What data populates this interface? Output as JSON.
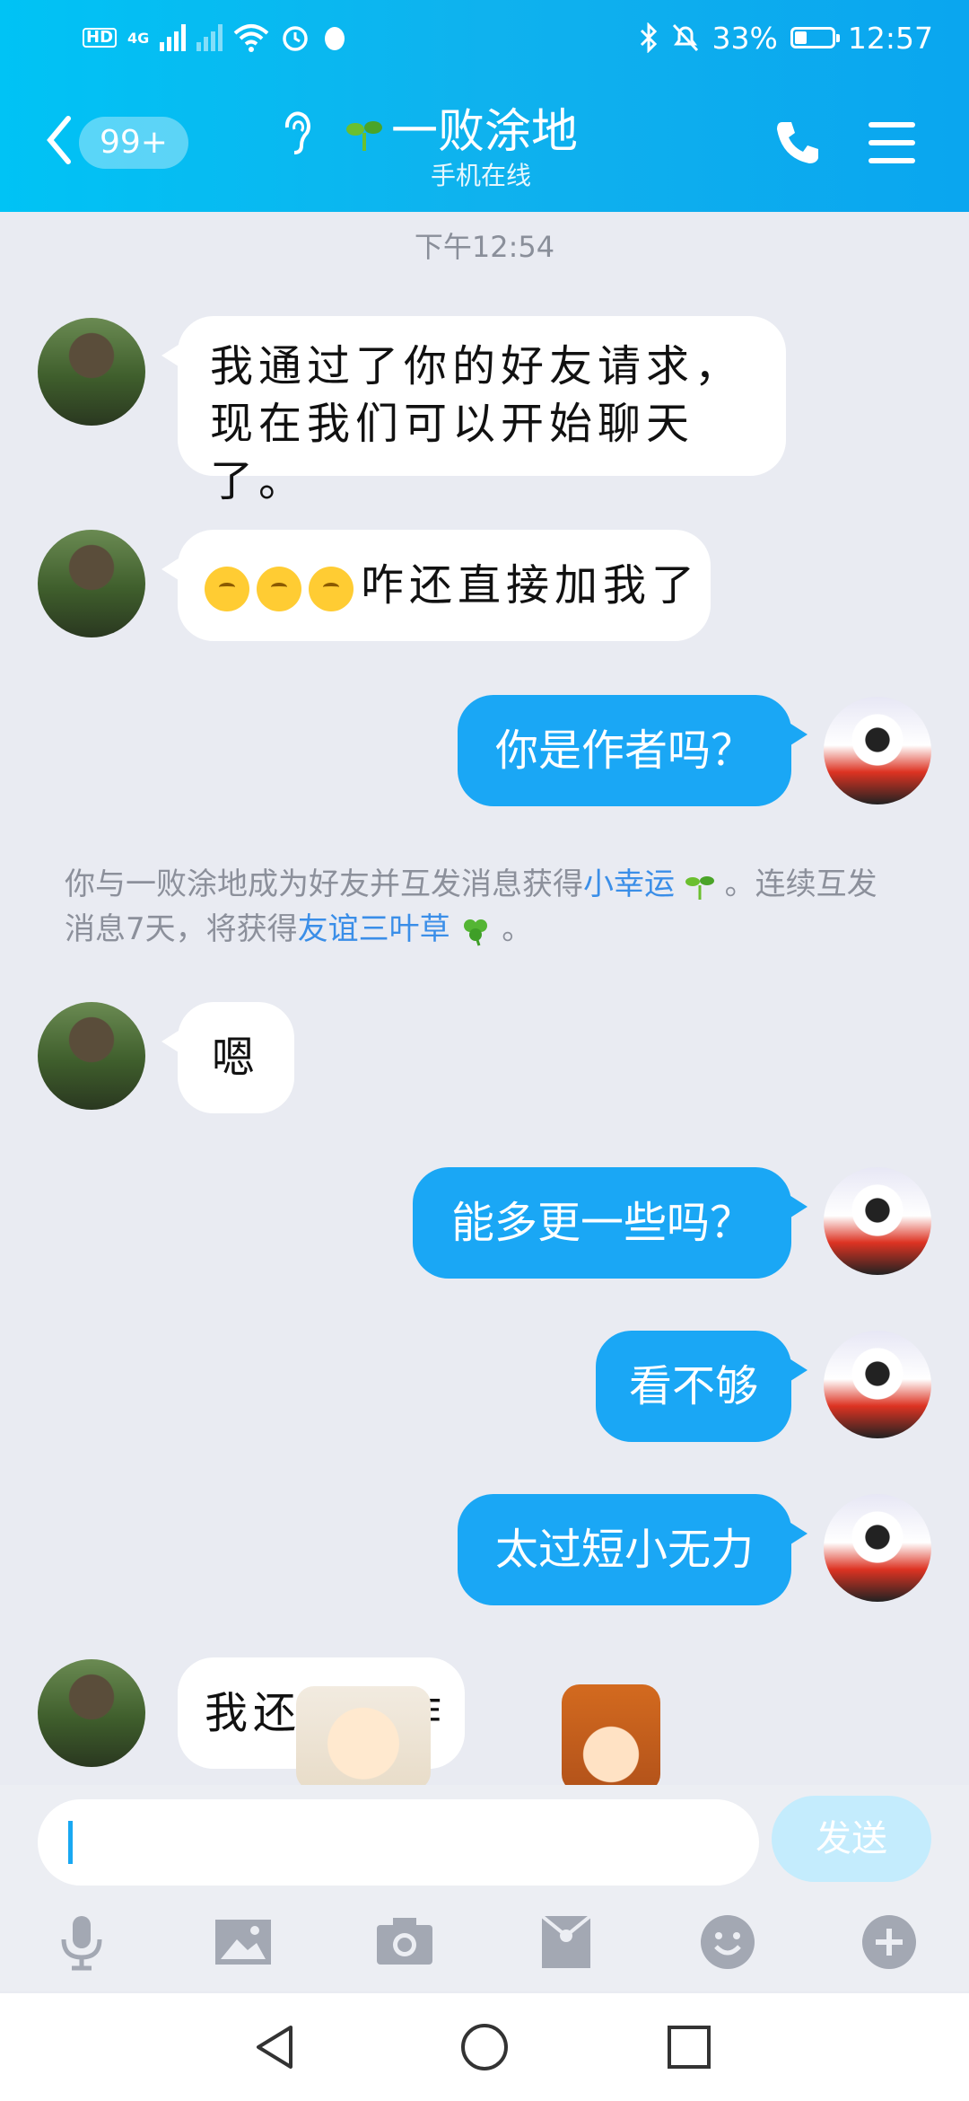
{
  "status_bar": {
    "hd_label": "HD",
    "network": "4G",
    "battery_percent": "33%",
    "battery_level": 0.33,
    "time": "12:57",
    "icons": [
      "signal-icon",
      "wifi-icon",
      "alarm-icon",
      "bluetooth-icon",
      "mute-icon",
      "battery-icon"
    ]
  },
  "header": {
    "unread_badge": "99+",
    "contact_name": "一败涂地",
    "contact_status": "手机在线"
  },
  "chat": {
    "timestamp": "下午12:54",
    "messages": [
      {
        "side": "left",
        "text": "我通过了你的好友请求，现在我们可以开始聊天了。"
      },
      {
        "side": "left",
        "text": "咋还直接加我了"
      },
      {
        "side": "right",
        "text": "你是作者吗？"
      },
      {
        "side": "left",
        "text": "嗯"
      },
      {
        "side": "right",
        "text": "能多更一些吗？"
      },
      {
        "side": "right",
        "text": "看不够"
      },
      {
        "side": "right",
        "text": "太过短小无力"
      },
      {
        "side": "left",
        "text": "我还得工作"
      }
    ],
    "notice": {
      "part1": "你与一败涂地成为好友并互发消息获得",
      "link1": "小幸运",
      "part2": "。连续互发消息7天，将获得",
      "link2": "友谊三叶草",
      "part3": "。"
    }
  },
  "composer": {
    "send_label": "发送",
    "toolbar_icons": [
      "microphone-icon",
      "image-icon",
      "camera-icon",
      "red-packet-icon",
      "emoji-icon",
      "plus-icon"
    ]
  },
  "colors": {
    "header_start": "#00c3f5",
    "header_end": "#0aa6ef",
    "bubble_outgoing": "#1aa7f5",
    "bubble_incoming": "#ffffff",
    "link": "#3a8ee8"
  }
}
